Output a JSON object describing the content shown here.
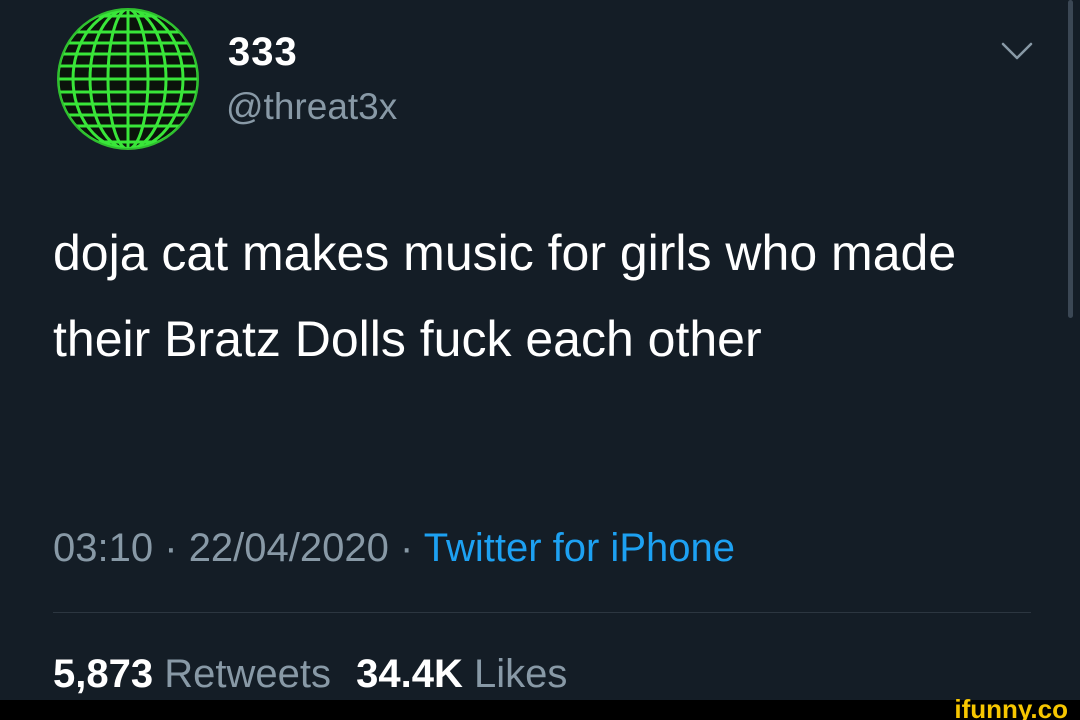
{
  "user": {
    "display_name": "333",
    "handle": "@threat3x",
    "avatar_icon": "wireframe-globe-icon"
  },
  "tweet": {
    "text": "doja cat makes music for girls who made their Bratz Dolls fuck each other",
    "time": "03:10",
    "date": "22/04/2020",
    "separator": "·",
    "source": "Twitter for iPhone"
  },
  "stats": {
    "retweets_count": "5,873",
    "retweets_label": "Retweets",
    "likes_count": "34.4K",
    "likes_label": "Likes"
  },
  "watermark": "ifunny.co",
  "colors": {
    "background": "#141d26",
    "secondary_text": "#8899a6",
    "link": "#1da1f2",
    "avatar_green": "#39e639",
    "watermark": "#f7c600"
  }
}
